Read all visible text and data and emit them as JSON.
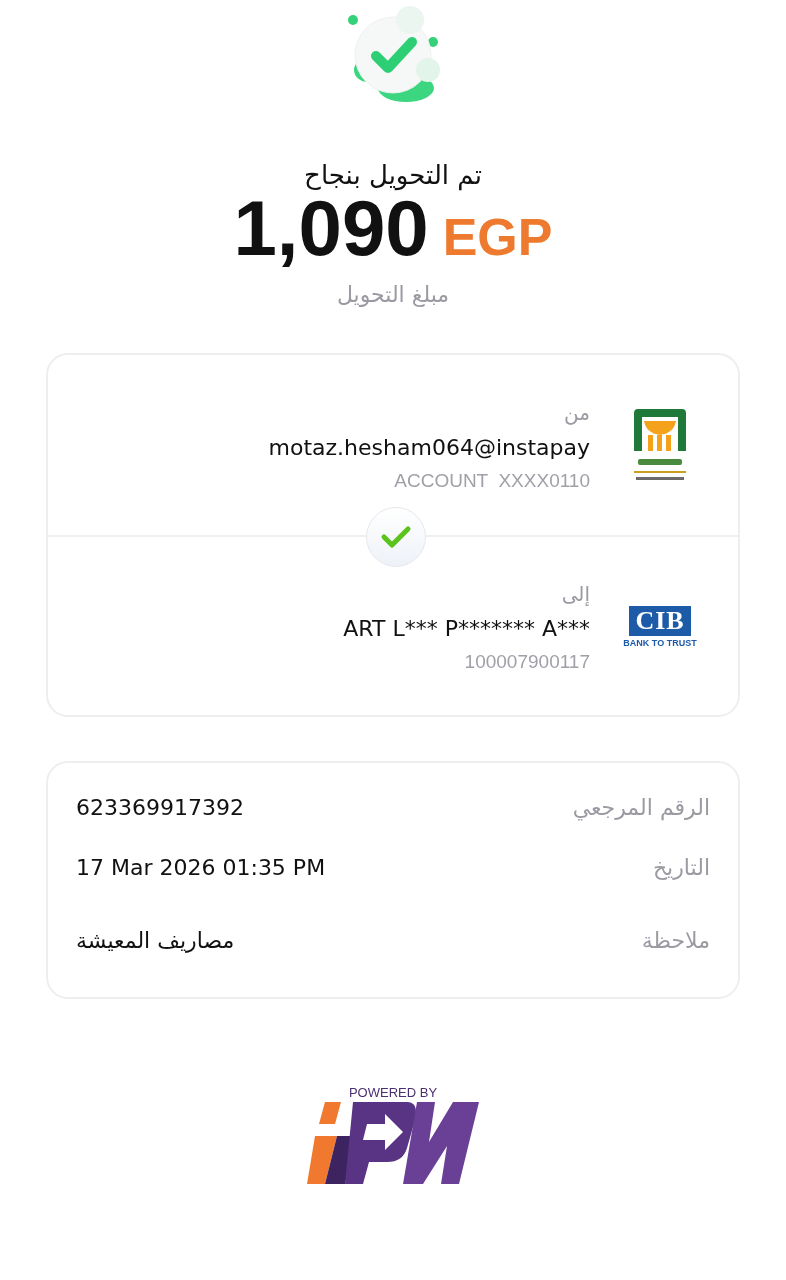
{
  "header": {
    "title": "تم التحويل بنجاح",
    "amount": "1,090",
    "currency": "EGP",
    "subtitle": "مبلغ التحويل"
  },
  "parties": [
    {
      "label": "من",
      "name": "motaz.hesham064@instapay",
      "account": "ACCOUNT  XXXX0110",
      "kind": "nbe"
    },
    {
      "label": "إلى",
      "name": "ART L*** P******* A***",
      "account": "100007900117",
      "kind": "cib",
      "logo_text": "CIB",
      "logo_tagline": "BANK TO TRUST"
    }
  ],
  "details": [
    {
      "label": "الرقم المرجعي",
      "value": "623369917392"
    },
    {
      "label": "التاريخ",
      "value": "17 Mar 2026 01:35 PM"
    },
    {
      "label": "ملاحظة",
      "value": "مصاريف المعيشة"
    }
  ],
  "footer": {
    "powered_by": "POWERED BY"
  }
}
